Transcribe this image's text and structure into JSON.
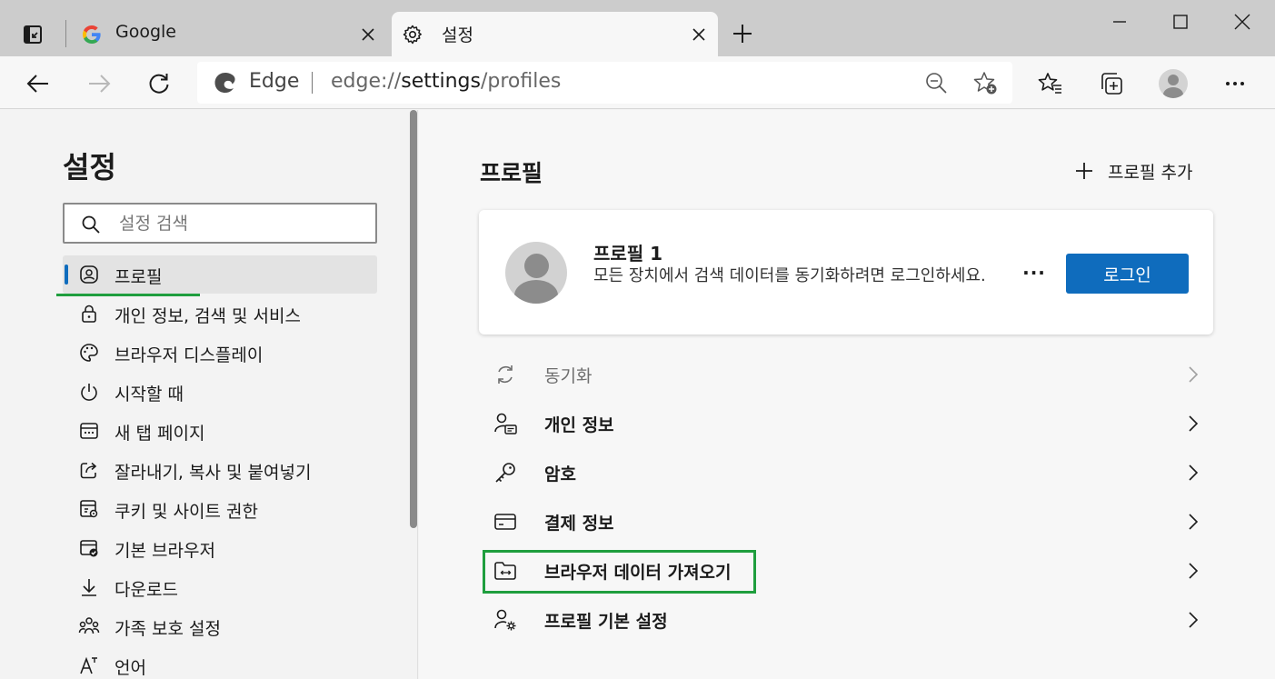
{
  "tabs": [
    {
      "title": "Google",
      "favicon": "google-icon",
      "active": false
    },
    {
      "title": "설정",
      "favicon": "gear-icon",
      "active": true
    }
  ],
  "address_bar": {
    "brand": "Edge",
    "url_prefix": "edge://",
    "url_highlight": "settings",
    "url_suffix": "/profiles"
  },
  "sidebar": {
    "title": "설정",
    "search_placeholder": "설정 검색",
    "items": [
      {
        "label": "프로필",
        "icon": "profile-icon",
        "selected": true
      },
      {
        "label": "개인 정보, 검색 및 서비스",
        "icon": "lock-icon"
      },
      {
        "label": "브라우저 디스플레이",
        "icon": "palette-icon"
      },
      {
        "label": "시작할 때",
        "icon": "power-icon"
      },
      {
        "label": "새 탭 페이지",
        "icon": "new-tab-icon"
      },
      {
        "label": "잘라내기, 복사 및 붙여넣기",
        "icon": "share-icon"
      },
      {
        "label": "쿠키 및 사이트 권한",
        "icon": "site-permissions-icon"
      },
      {
        "label": "기본 브라우저",
        "icon": "default-browser-icon"
      },
      {
        "label": "다운로드",
        "icon": "download-icon"
      },
      {
        "label": "가족 보호 설정",
        "icon": "family-icon"
      },
      {
        "label": "언어",
        "icon": "language-icon"
      }
    ]
  },
  "main": {
    "title": "프로필",
    "add_profile_label": "프로필 추가",
    "profile_card": {
      "name": "프로필 1",
      "description": "모든 장치에서 검색 데이터를 동기화하려면 로그인하세요.",
      "more_label": "···",
      "login_label": "로그인"
    },
    "rows": [
      {
        "label": "동기화",
        "icon": "sync-icon",
        "disabled": true
      },
      {
        "label": "개인 정보",
        "icon": "personal-info-icon"
      },
      {
        "label": "암호",
        "icon": "key-icon"
      },
      {
        "label": "결제 정보",
        "icon": "credit-card-icon"
      },
      {
        "label": "브라우저 데이터 가져오기",
        "icon": "import-folder-icon",
        "highlighted": true
      },
      {
        "label": "프로필 기본 설정",
        "icon": "profile-settings-icon"
      }
    ]
  },
  "colors": {
    "accent": "#0f6cbd",
    "highlight_green": "#1f9e3e"
  }
}
